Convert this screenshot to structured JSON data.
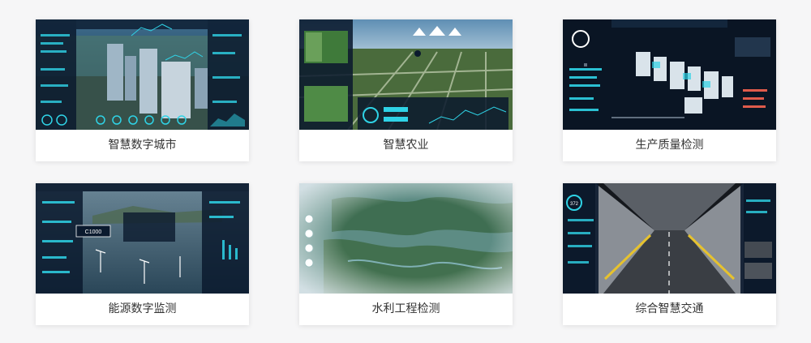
{
  "cards": [
    {
      "title": "智慧数字城市",
      "icon": "smart-city-screenshot"
    },
    {
      "title": "智慧农业",
      "icon": "smart-agriculture-screenshot"
    },
    {
      "title": "生产质量检测",
      "icon": "production-quality-screenshot"
    },
    {
      "title": "能源数字监测",
      "icon": "energy-monitoring-screenshot"
    },
    {
      "title": "水利工程检测",
      "icon": "water-conservancy-screenshot"
    },
    {
      "title": "综合智慧交通",
      "icon": "smart-transport-screenshot"
    }
  ],
  "thumb_labels": {
    "energy_value": "C1000",
    "traffic_value": "372"
  },
  "colors": {
    "page_bg": "#f6f6f7",
    "card_bg": "#ffffff",
    "caption_text": "#333333",
    "dashboard_dark": "#0b1a2e",
    "accent_cyan": "#2fd3e6"
  }
}
